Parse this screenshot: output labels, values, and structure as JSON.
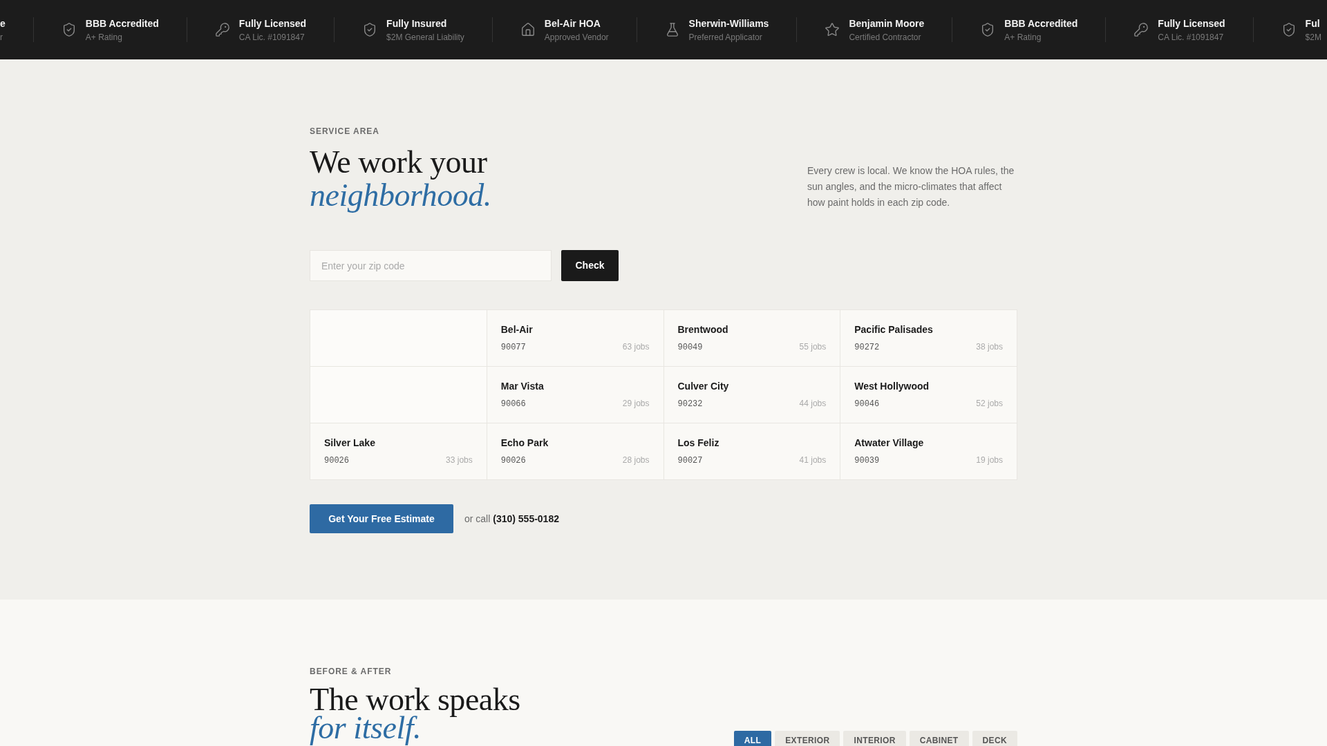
{
  "trust_bar": {
    "items": [
      {
        "kind": "clipped",
        "title": "e",
        "detail": "r"
      },
      {
        "kind": "accreditation",
        "title": "BBB Accredited",
        "detail": "A+ Rating"
      },
      {
        "kind": "license",
        "title": "Fully Licensed",
        "detail": "CA Lic. #1091847"
      },
      {
        "kind": "insurance",
        "title": "Fully Insured",
        "detail": "$2M General Liability"
      },
      {
        "kind": "hoa",
        "title": "Bel-Air HOA",
        "detail": "Approved Vendor"
      },
      {
        "kind": "paint_brand",
        "title": "Sherwin-Williams",
        "detail": "Preferred Applicator"
      },
      {
        "kind": "contractor",
        "title": "Benjamin Moore",
        "detail": "Certified Contractor"
      },
      {
        "kind": "accreditation",
        "title": "BBB Accredited",
        "detail": "A+ Rating"
      },
      {
        "kind": "license",
        "title": "Fully Licensed",
        "detail": "CA Lic. #1091847"
      },
      {
        "kind": "insurance",
        "title": "Ful",
        "detail": "$2M"
      }
    ]
  },
  "service_area": {
    "eyebrow": "SERVICE AREA",
    "heading": "We work your *neighborhood.*",
    "intro": "Every crew is local. We know the HOA rules, the sun angles, and the micro-climates that affect how paint holds in each zip code.",
    "zip_field": {
      "placeholder": "Enter your zip code"
    },
    "check_button": "Check",
    "areas": [
      {
        "kind": "faded"
      },
      {
        "kind": "area",
        "name": "Bel-Air",
        "zip": "90077",
        "jobs": "63 jobs"
      },
      {
        "kind": "area",
        "name": "Brentwood",
        "zip": "90049",
        "jobs": "55 jobs"
      },
      {
        "kind": "area",
        "name": "Pacific Palisades",
        "zip": "90272",
        "jobs": "38 jobs"
      },
      {
        "kind": "faded"
      },
      {
        "kind": "area",
        "name": "Mar Vista",
        "zip": "90066",
        "jobs": "29 jobs"
      },
      {
        "kind": "area",
        "name": "Culver City",
        "zip": "90232",
        "jobs": "44 jobs"
      },
      {
        "kind": "area",
        "name": "West Hollywood",
        "zip": "90046",
        "jobs": "52 jobs"
      },
      {
        "kind": "area",
        "name": "Silver Lake",
        "zip": "90026",
        "jobs": "33 jobs"
      },
      {
        "kind": "area",
        "name": "Echo Park",
        "zip": "90026",
        "jobs": "28 jobs"
      },
      {
        "kind": "area",
        "name": "Los Feliz",
        "zip": "90027",
        "jobs": "41 jobs"
      },
      {
        "kind": "area",
        "name": "Atwater Village",
        "zip": "90039",
        "jobs": "19 jobs"
      }
    ],
    "cta_button": "Get Your Free Estimate",
    "call_text": "or call **(310) 555-0182**"
  },
  "before_after": {
    "eyebrow": "BEFORE & AFTER",
    "heading": "The work speaks *for itself.*",
    "filters": [
      {
        "label": "ALL",
        "selected": true
      },
      {
        "label": "EXTERIOR",
        "selected": false
      },
      {
        "label": "INTERIOR",
        "selected": false
      },
      {
        "label": "CABINET",
        "selected": false
      },
      {
        "label": "DECK",
        "selected": false
      }
    ]
  }
}
